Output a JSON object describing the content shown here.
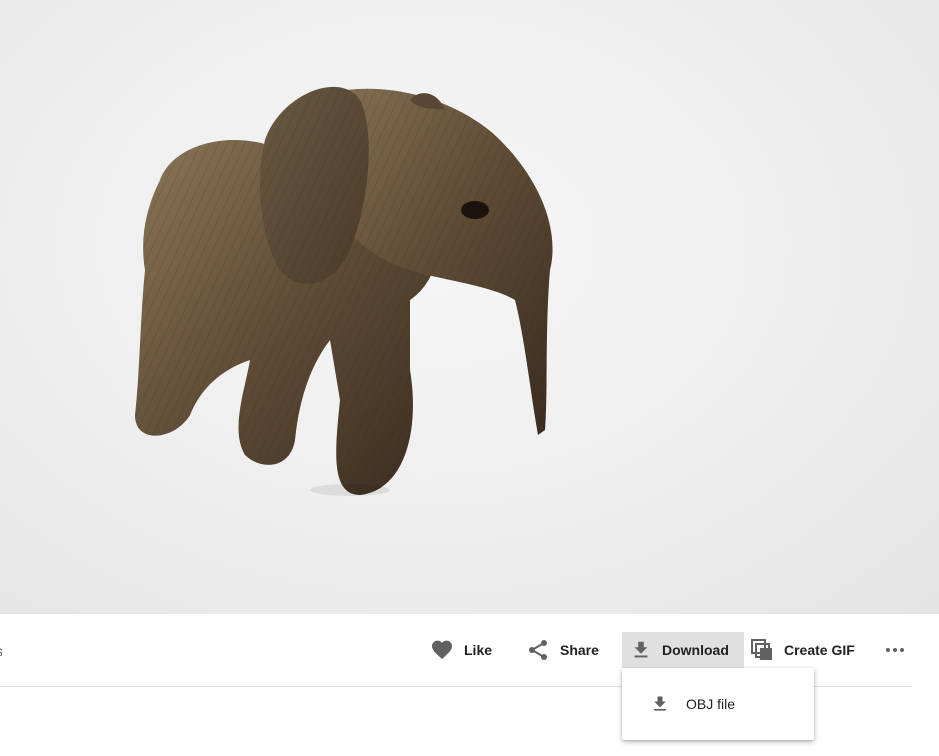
{
  "actions": {
    "like_label": "Like",
    "share_label": "Share",
    "download_label": "Download",
    "create_gif_label": "Create GIF",
    "more_label": "..."
  },
  "download_menu": {
    "items": [
      {
        "label": "OBJ file",
        "icon": "download-icon"
      }
    ]
  },
  "colors": {
    "background": "#eeeeee",
    "active_button": "#e0e0e0",
    "icon": "#616161",
    "text": "#212121"
  }
}
